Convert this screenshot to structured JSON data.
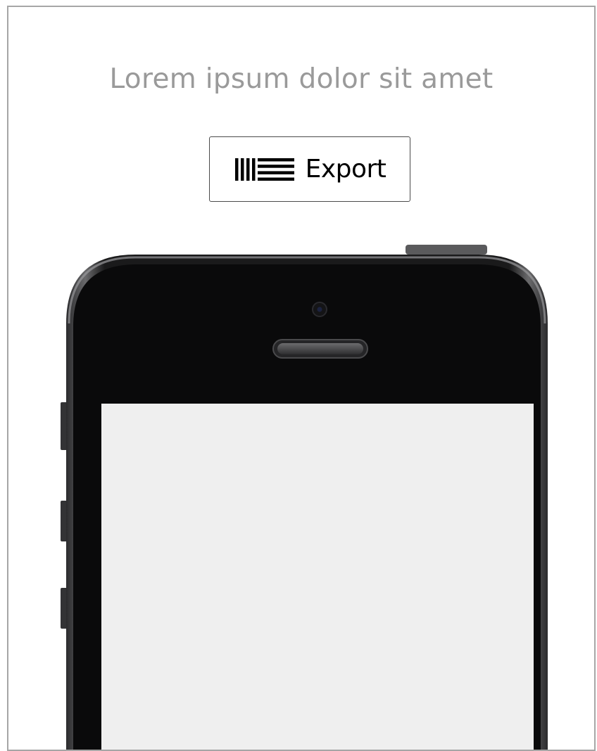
{
  "headline": "Lorem ipsum dolor sit amet",
  "export_button": {
    "label": "Export",
    "icon": "ableton-logo-icon"
  },
  "phone": {
    "screen_color": "#efefef",
    "body_color": "#0a0a0b"
  }
}
